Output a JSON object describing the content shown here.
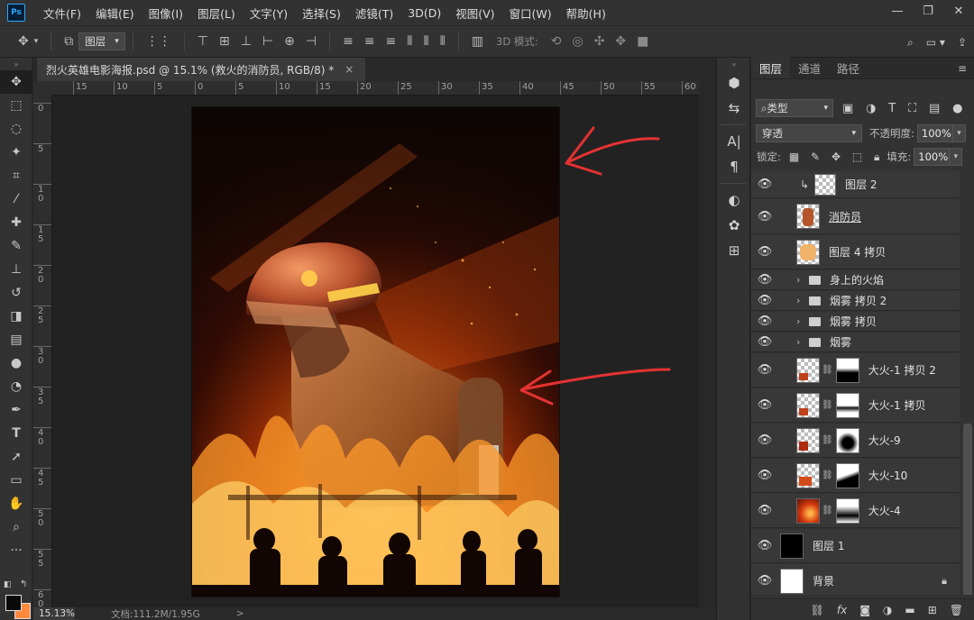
{
  "app": {
    "logo_text": "Ps"
  },
  "menu": [
    "文件(F)",
    "编辑(E)",
    "图像(I)",
    "图层(L)",
    "文字(Y)",
    "选择(S)",
    "滤镜(T)",
    "3D(D)",
    "视图(V)",
    "窗口(W)",
    "帮助(H)"
  ],
  "options_bar": {
    "target_select": "图层",
    "mode_3d_label": "3D 模式:"
  },
  "document": {
    "tab_title": "烈火英雄电影海报.psd @ 15.1% (救火的消防员, RGB/8) *",
    "close_glyph": "×"
  },
  "ruler_h": [
    "15",
    "10",
    "5",
    "0",
    "5",
    "10",
    "15",
    "20",
    "25",
    "30",
    "35",
    "40",
    "45",
    "50",
    "55",
    "60"
  ],
  "ruler_v": [
    "0",
    "5",
    "1 0",
    "1 5",
    "2 0",
    "2 5",
    "3 0",
    "3 5",
    "4 0",
    "4 5",
    "5 0",
    "5 5",
    "6 0"
  ],
  "status": {
    "zoom": "15.13%",
    "doc_info": "文档:111.2M/1.95G",
    "arrow": ">"
  },
  "layers_panel": {
    "tabs": [
      "图层",
      "通道",
      "路径"
    ],
    "filter_label": "类型",
    "blend_mode": "穿透",
    "opacity_label": "不透明度:",
    "opacity_value": "100%",
    "lock_label": "锁定:",
    "fill_label": "填充:",
    "fill_value": "100%",
    "layers": [
      {
        "name": "图层 2",
        "kind": "clipped"
      },
      {
        "name": "消防员",
        "kind": "pixel"
      },
      {
        "name": "图层 4 拷贝",
        "kind": "pixel"
      },
      {
        "name": "身上的火焰",
        "kind": "group"
      },
      {
        "name": "烟雾 拷贝 2",
        "kind": "group"
      },
      {
        "name": "烟雾 拷贝",
        "kind": "group"
      },
      {
        "name": "烟雾",
        "kind": "group"
      },
      {
        "name": "大火-1 拷贝 2",
        "kind": "masked"
      },
      {
        "name": "大火-1 拷贝",
        "kind": "masked"
      },
      {
        "name": "大火-9",
        "kind": "masked"
      },
      {
        "name": "大火-10",
        "kind": "masked"
      },
      {
        "name": "大火-4",
        "kind": "masked"
      },
      {
        "name": "图层 1",
        "kind": "pixel"
      },
      {
        "name": "背景",
        "kind": "background"
      }
    ]
  },
  "annotation_color": "#e53232",
  "accent_color": "#31a8ff"
}
